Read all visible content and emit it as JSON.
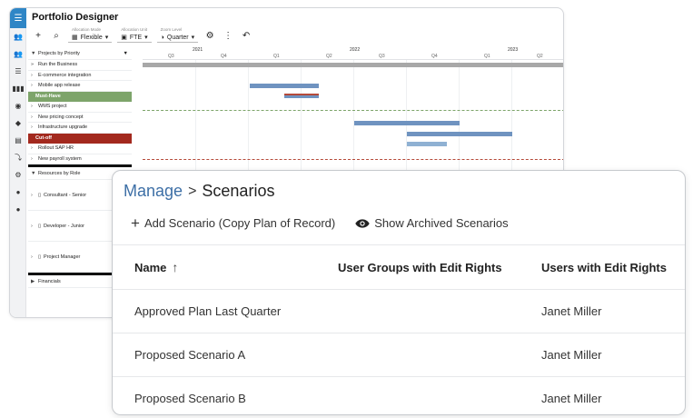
{
  "portfolio": {
    "title": "Portfolio Designer",
    "toolbar": {
      "allocation_mode_label": "Allocation Mode",
      "allocation_mode_value": "Flexible",
      "allocation_unit_label": "Allocation Unit",
      "allocation_unit_value": "FTE",
      "zoom_level_label": "Zoom Level",
      "zoom_level_value": "Quarter"
    },
    "left_header": "Projects by Priority",
    "rows": [
      "Run the Business",
      "E-commerce integration",
      "Mobile app release",
      "Must-Have",
      "WMS project",
      "New pricing concept",
      "Infrastructure upgrade",
      "Cut-off",
      "Rollout SAP HR",
      "New payroll system"
    ],
    "resources_header": "Resources by Role",
    "resources": [
      "Consultant - Senior",
      "Developer - Junior",
      "Project Manager"
    ],
    "financials": "Financials",
    "years": [
      "2021",
      "2022",
      "2023"
    ],
    "quarters": [
      "Q3",
      "Q4",
      "Q1",
      "Q2",
      "Q3",
      "Q4",
      "Q1",
      "Q2"
    ],
    "colors": {
      "brand": "#2f86c6",
      "must_have": "#7da46a",
      "cut_off": "#a3291e",
      "bar_blue": "#6f93c0",
      "bar_light": "#8fb1d3",
      "bar_gray": "#a8a8a8",
      "bar_red": "#b54a3a"
    }
  },
  "scenarios": {
    "breadcrumb_root": "Manage",
    "breadcrumb_separator": ">",
    "breadcrumb_current": "Scenarios",
    "add_label": "Add Scenario (Copy Plan of Record)",
    "archived_label": "Show Archived Scenarios",
    "columns": [
      "Name",
      "User Groups with Edit Rights",
      "Users with Edit Rights"
    ],
    "rows": [
      {
        "name": "Approved Plan Last Quarter",
        "groups": "",
        "users": "Janet Miller"
      },
      {
        "name": "Proposed Scenario A",
        "groups": "",
        "users": "Janet Miller"
      },
      {
        "name": "Proposed Scenario B",
        "groups": "",
        "users": "Janet Miller"
      }
    ]
  }
}
